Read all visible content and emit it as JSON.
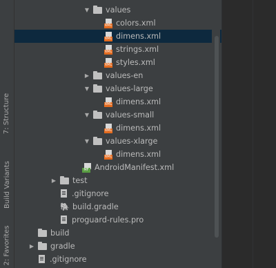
{
  "side_toolbar": {
    "structure_label": "7: Structure",
    "build_variants_label": "Build Variants",
    "favorites_label": "2: Favorites"
  },
  "tree": {
    "items": [
      {
        "label": "values",
        "type": "folder",
        "expanded": true,
        "level": 6
      },
      {
        "label": "colors.xml",
        "type": "xml",
        "level": 7
      },
      {
        "label": "dimens.xml",
        "type": "xml",
        "level": 7,
        "selected": true
      },
      {
        "label": "strings.xml",
        "type": "xml",
        "level": 7
      },
      {
        "label": "styles.xml",
        "type": "xml",
        "level": 7
      },
      {
        "label": "values-en",
        "type": "folder",
        "expanded": false,
        "level": 6
      },
      {
        "label": "values-large",
        "type": "folder",
        "expanded": true,
        "level": 6
      },
      {
        "label": "dimens.xml",
        "type": "xml",
        "level": 7
      },
      {
        "label": "values-small",
        "type": "folder",
        "expanded": true,
        "level": 6
      },
      {
        "label": "dimens.xml",
        "type": "xml",
        "level": 7
      },
      {
        "label": "values-xlarge",
        "type": "folder",
        "expanded": true,
        "level": 6
      },
      {
        "label": "dimens.xml",
        "type": "xml",
        "level": 7
      },
      {
        "label": "AndroidManifest.xml",
        "type": "manifest",
        "level": 5
      },
      {
        "label": "test",
        "type": "folder",
        "expanded": false,
        "level": 3
      },
      {
        "label": ".gitignore",
        "type": "file",
        "level": 3
      },
      {
        "label": "build.gradle",
        "type": "gradle",
        "level": 3
      },
      {
        "label": "proguard-rules.pro",
        "type": "file",
        "level": 3
      },
      {
        "label": "build",
        "type": "folder",
        "level": 1
      },
      {
        "label": "gradle",
        "type": "folder",
        "expanded": false,
        "level": 1
      },
      {
        "label": ".gitignore",
        "type": "file",
        "level": 1
      }
    ]
  },
  "colors": {
    "panel_bg": "#3c3f41",
    "selection_bg": "#0d293e",
    "editor_bg": "#2b2b2b",
    "xml_icon": "#e46b1f",
    "manifest_icon": "#5a9e43"
  }
}
